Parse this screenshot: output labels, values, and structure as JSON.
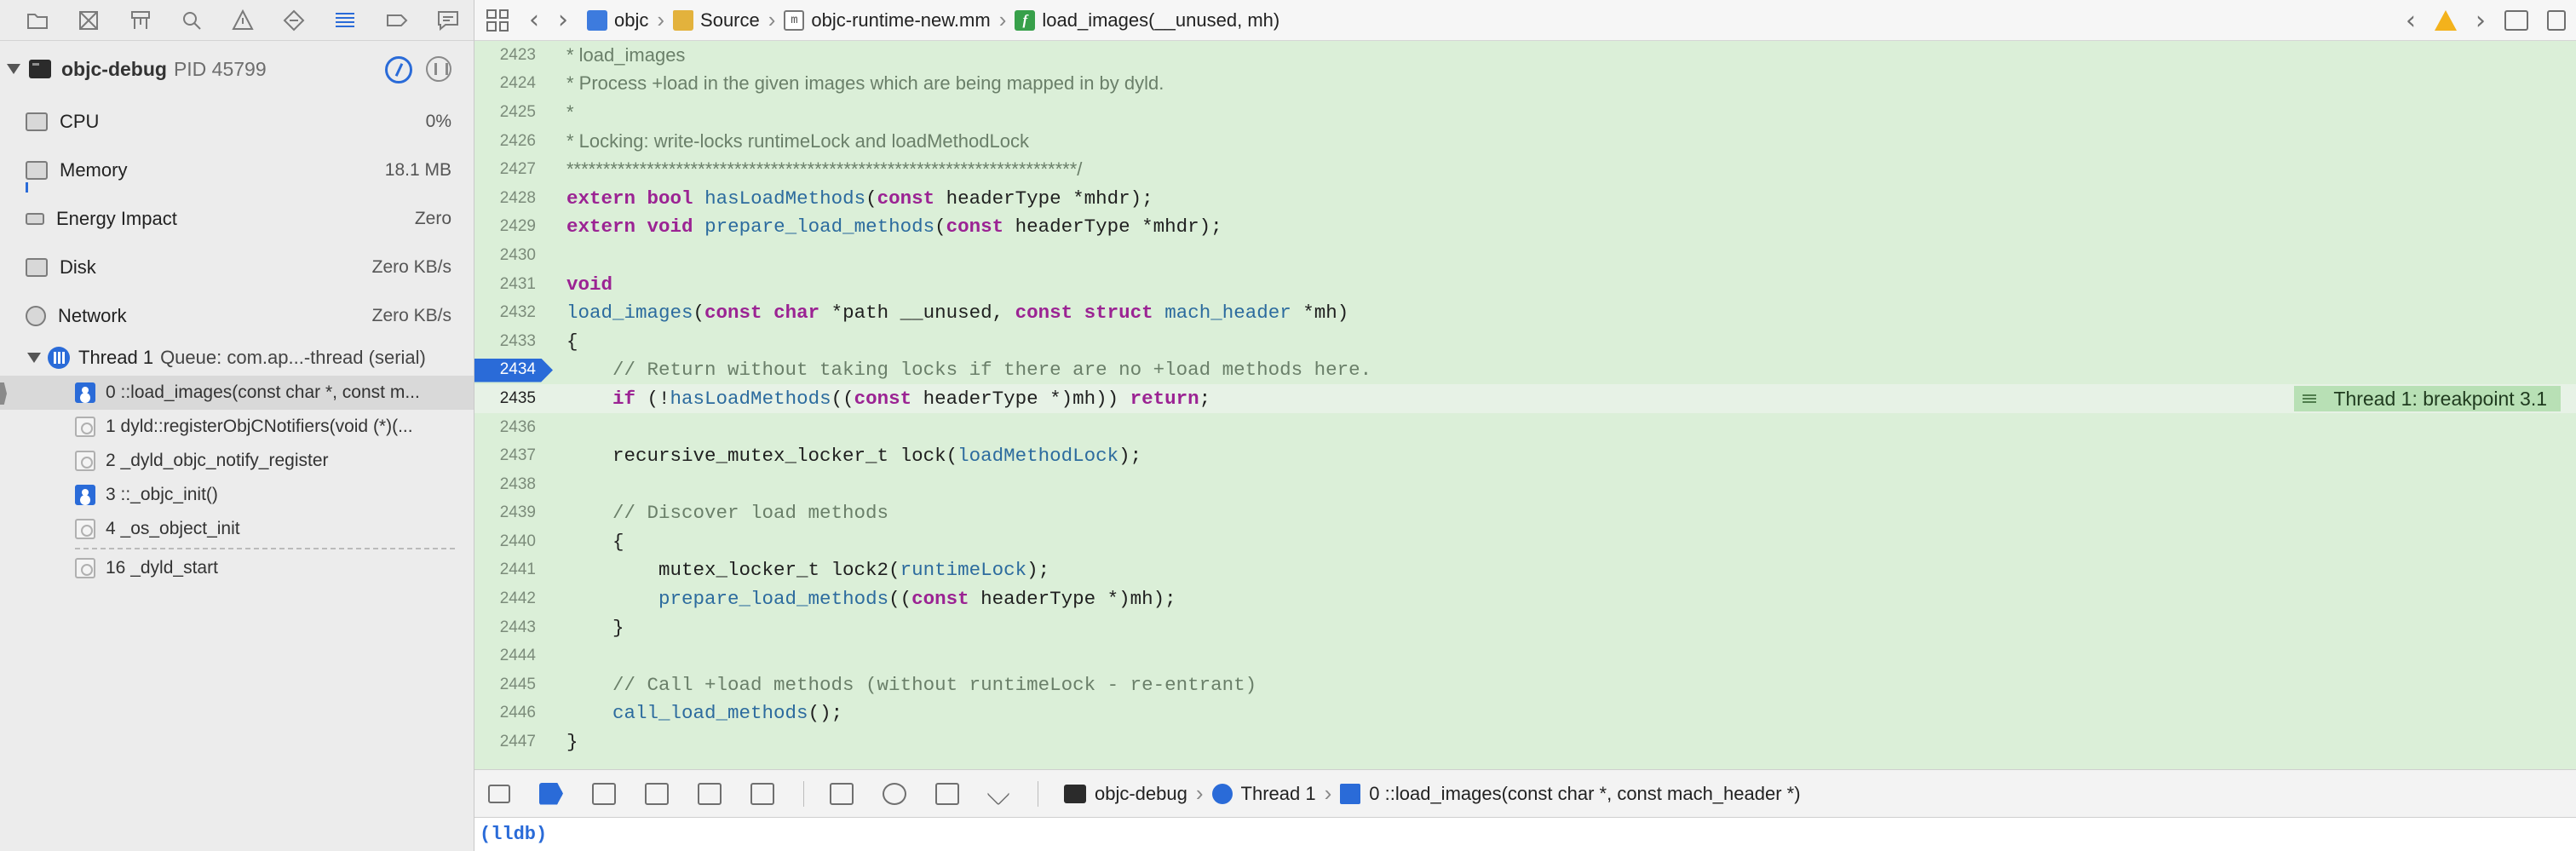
{
  "navigator": {
    "tabs": [
      "folder-icon",
      "source-control-icon",
      "symbol-icon",
      "find-icon",
      "issue-icon",
      "test-icon",
      "debug-icon",
      "breakpoint-icon",
      "report-icon"
    ],
    "process": {
      "name": "objc-debug",
      "pid": "PID 45799"
    },
    "gauges": [
      {
        "label": "CPU",
        "value": "0%"
      },
      {
        "label": "Memory",
        "value": "18.1 MB"
      },
      {
        "label": "Energy Impact",
        "value": "Zero"
      },
      {
        "label": "Disk",
        "value": "Zero KB/s"
      },
      {
        "label": "Network",
        "value": "Zero KB/s"
      }
    ],
    "thread": {
      "label": "Thread 1",
      "queue": "Queue: com.ap...-thread (serial)"
    },
    "frames": [
      {
        "text": "0 ::load_images(const char *, const m...",
        "kind": "user",
        "selected": true
      },
      {
        "text": "1 dyld::registerObjCNotifiers(void (*)(...",
        "kind": "sys"
      },
      {
        "text": "2 _dyld_objc_notify_register",
        "kind": "sys"
      },
      {
        "text": "3 ::_objc_init()",
        "kind": "user"
      },
      {
        "text": "4 _os_object_init",
        "kind": "sys"
      },
      {
        "text": "16 _dyld_start",
        "kind": "sys"
      }
    ]
  },
  "jumpbar": {
    "crumbs": [
      "objc",
      "Source",
      "objc-runtime-new.mm",
      "load_images(__unused, mh)"
    ],
    "file_glyph": "m",
    "func_glyph": "f"
  },
  "code": {
    "lines": [
      {
        "n": "2423",
        "html": [
          [
            "c-comment",
            "* load_images"
          ]
        ]
      },
      {
        "n": "2424",
        "html": [
          [
            "c-comment",
            "* Process +load in the given images which are being mapped in by dyld."
          ]
        ]
      },
      {
        "n": "2425",
        "html": [
          [
            "c-comment",
            "*"
          ]
        ]
      },
      {
        "n": "2426",
        "html": [
          [
            "c-comment",
            "* Locking: write-locks runtimeLock and loadMethodLock"
          ]
        ]
      },
      {
        "n": "2427",
        "html": [
          [
            "c-comment",
            "**********************************************************************/"
          ]
        ]
      },
      {
        "n": "2428",
        "html": [
          [
            "c-kw",
            "extern"
          ],
          [
            "c-plain",
            " "
          ],
          [
            "c-kw",
            "bool"
          ],
          [
            "c-plain",
            " "
          ],
          [
            "c-fn",
            "hasLoadMethods"
          ],
          [
            "c-plain",
            "("
          ],
          [
            "c-kw",
            "const"
          ],
          [
            "c-plain",
            " headerType *mhdr);"
          ]
        ]
      },
      {
        "n": "2429",
        "html": [
          [
            "c-kw",
            "extern"
          ],
          [
            "c-plain",
            " "
          ],
          [
            "c-kw",
            "void"
          ],
          [
            "c-plain",
            " "
          ],
          [
            "c-fn",
            "prepare_load_methods"
          ],
          [
            "c-plain",
            "("
          ],
          [
            "c-kw",
            "const"
          ],
          [
            "c-plain",
            " headerType *mhdr);"
          ]
        ]
      },
      {
        "n": "2430",
        "html": []
      },
      {
        "n": "2431",
        "html": [
          [
            "c-kw",
            "void"
          ]
        ]
      },
      {
        "n": "2432",
        "html": [
          [
            "c-fn",
            "load_images"
          ],
          [
            "c-plain",
            "("
          ],
          [
            "c-kw",
            "const"
          ],
          [
            "c-plain",
            " "
          ],
          [
            "c-kw",
            "char"
          ],
          [
            "c-plain",
            " *path __unused, "
          ],
          [
            "c-kw",
            "const"
          ],
          [
            "c-plain",
            " "
          ],
          [
            "c-kw",
            "struct"
          ],
          [
            "c-plain",
            " "
          ],
          [
            "c-fn",
            "mach_header"
          ],
          [
            "c-plain",
            " *mh)"
          ]
        ]
      },
      {
        "n": "2433",
        "html": [
          [
            "c-plain",
            "{"
          ]
        ]
      },
      {
        "n": "2434",
        "bp": true,
        "html": [
          [
            "c-comment-mono",
            "    // Return without taking locks if there are no +load methods here."
          ]
        ]
      },
      {
        "n": "2435",
        "cur": true,
        "html": [
          [
            "c-plain",
            "    "
          ],
          [
            "c-kw",
            "if"
          ],
          [
            "c-plain",
            " (!"
          ],
          [
            "c-fn",
            "hasLoadMethods"
          ],
          [
            "c-plain",
            "(("
          ],
          [
            "c-kw",
            "const"
          ],
          [
            "c-plain",
            " headerType *)mh)) "
          ],
          [
            "c-kw",
            "return"
          ],
          [
            "c-plain",
            ";"
          ]
        ]
      },
      {
        "n": "2436",
        "html": []
      },
      {
        "n": "2437",
        "html": [
          [
            "c-plain",
            "    recursive_mutex_locker_t lock("
          ],
          [
            "c-fn",
            "loadMethodLock"
          ],
          [
            "c-plain",
            ");"
          ]
        ]
      },
      {
        "n": "2438",
        "html": []
      },
      {
        "n": "2439",
        "html": [
          [
            "c-comment-mono",
            "    // Discover load methods"
          ]
        ]
      },
      {
        "n": "2440",
        "html": [
          [
            "c-plain",
            "    {"
          ]
        ]
      },
      {
        "n": "2441",
        "html": [
          [
            "c-plain",
            "        mutex_locker_t lock2("
          ],
          [
            "c-fn",
            "runtimeLock"
          ],
          [
            "c-plain",
            ");"
          ]
        ]
      },
      {
        "n": "2442",
        "html": [
          [
            "c-plain",
            "        "
          ],
          [
            "c-fn",
            "prepare_load_methods"
          ],
          [
            "c-plain",
            "(("
          ],
          [
            "c-kw",
            "const"
          ],
          [
            "c-plain",
            " headerType *)mh);"
          ]
        ]
      },
      {
        "n": "2443",
        "html": [
          [
            "c-plain",
            "    }"
          ]
        ]
      },
      {
        "n": "2444",
        "html": []
      },
      {
        "n": "2445",
        "html": [
          [
            "c-comment-mono",
            "    // Call +load methods (without runtimeLock - re-entrant)"
          ]
        ]
      },
      {
        "n": "2446",
        "html": [
          [
            "c-plain",
            "    "
          ],
          [
            "c-fn",
            "call_load_methods"
          ],
          [
            "c-plain",
            "();"
          ]
        ]
      },
      {
        "n": "2447",
        "html": [
          [
            "c-plain",
            "}"
          ]
        ]
      }
    ],
    "breakpoint_badge": "Thread 1: breakpoint 3.1"
  },
  "debugbar": {
    "process": "objc-debug",
    "thread": "Thread 1",
    "frame": "0 ::load_images(const char *, const mach_header *)"
  },
  "console": {
    "prompt": "(lldb)"
  },
  "colors": {
    "accent": "#2a6bd8",
    "editor_bg": "#dbefd8",
    "keyword": "#9b2393",
    "function": "#2c6b9e",
    "comment": "#6a7f69"
  }
}
